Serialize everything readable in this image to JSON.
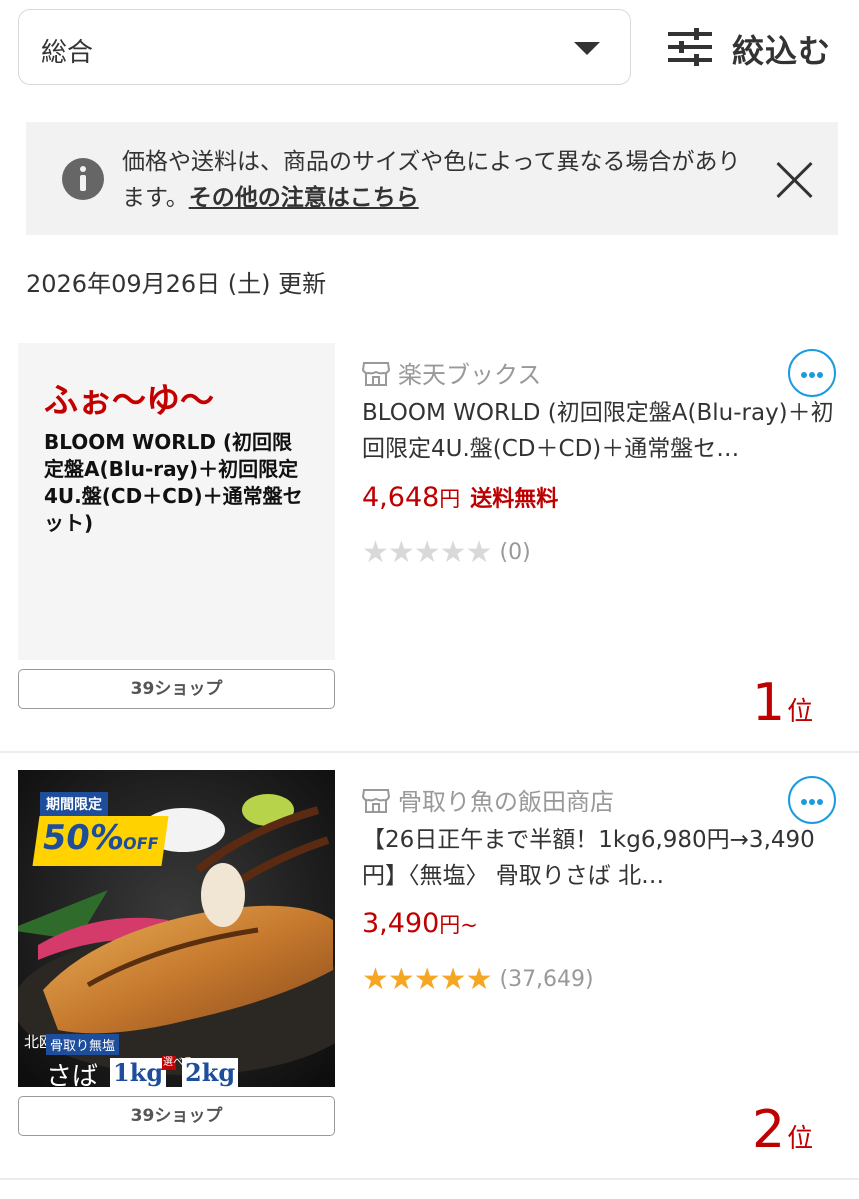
{
  "sort": {
    "selected": "総合"
  },
  "filter": {
    "label": "絞込む"
  },
  "notice": {
    "text": "価格や送料は、商品のサイズや色によって異なる場合があります。",
    "link": "その他の注意はこちら"
  },
  "updated": "2026年09月26日 (土) 更新",
  "products": [
    {
      "thumb_brand": "ふぉ〜ゆ〜",
      "thumb_title": "BLOOM WORLD (初回限定盤A(Blu-ray)＋初回限定4U.盤(CD＋CD)＋通常盤セット)",
      "store": "楽天ブックス",
      "name": "BLOOM WORLD (初回限定盤A(Blu-ray)＋初回限定4U.盤(CD＋CD)＋通常盤セ…",
      "price": "4,648",
      "yen": "円",
      "shipping": "送料無料",
      "stars": "★★★★★",
      "review_count": "(0)",
      "shop_button": "39ショップ",
      "rank": "1",
      "rank_unit": "位"
    },
    {
      "badge_ribbon": "期間限定",
      "badge_pct": "50%",
      "badge_off": "OFF",
      "tag_region": "北欧産",
      "tag_kind": "骨取り無塩",
      "tag_name": "さば",
      "tag_w1": "1kg",
      "tag_choose": "選べる",
      "tag_w2": "2kg",
      "store": "骨取り魚の飯田商店",
      "name": "【26日正午まで半額！1kg6,980円→3,490円】〈無塩〉 骨取りさば 北…",
      "price": "3,490",
      "yen": "円",
      "tilde": "~",
      "stars": "★★★★★",
      "review_count": "(37,649)",
      "shop_button": "39ショップ",
      "rank": "2",
      "rank_unit": "位"
    }
  ],
  "colors": {
    "accent_red": "#bf0000",
    "link_blue": "#1a9be0",
    "star": "#f5a623"
  }
}
